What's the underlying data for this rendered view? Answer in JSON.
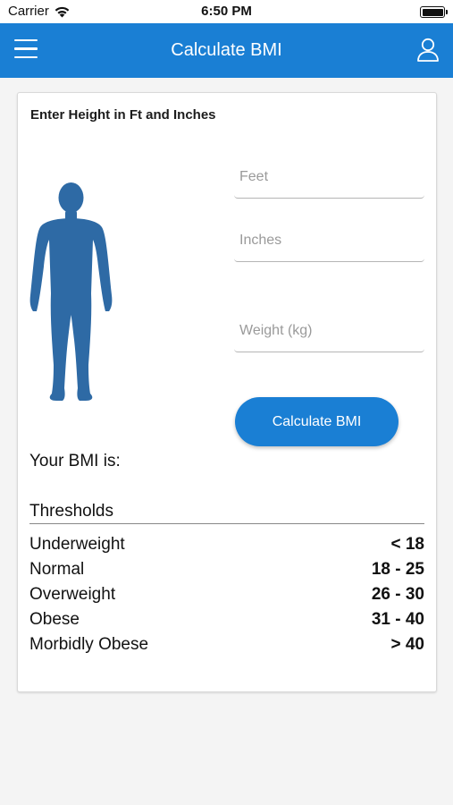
{
  "status_bar": {
    "carrier": "Carrier",
    "time": "6:50 PM"
  },
  "nav": {
    "title": "Calculate BMI",
    "icons": [
      "menu-icon",
      "user-icon"
    ]
  },
  "form": {
    "heading": "Enter Height in Ft and Inches",
    "feet": {
      "value": "",
      "placeholder": "Feet"
    },
    "inches": {
      "value": "",
      "placeholder": "Inches"
    },
    "weight": {
      "value": "",
      "placeholder": "Weight (kg)"
    },
    "calculate_label": "Calculate BMI",
    "figure_icon": "human-figure-icon"
  },
  "result": {
    "label": "Your BMI is:"
  },
  "thresholds": {
    "title": "Thresholds",
    "rows": [
      {
        "label": "Underweight",
        "value": "< 18"
      },
      {
        "label": "Normal",
        "value": "18 - 25"
      },
      {
        "label": "Overweight",
        "value": "26 - 30"
      },
      {
        "label": "Obese",
        "value": "31 - 40"
      },
      {
        "label": "Morbidly Obese",
        "value": "> 40"
      }
    ]
  },
  "colors": {
    "brand": "#1a7fd4",
    "figure": "#2e6aa5",
    "background": "#f4f4f4"
  }
}
